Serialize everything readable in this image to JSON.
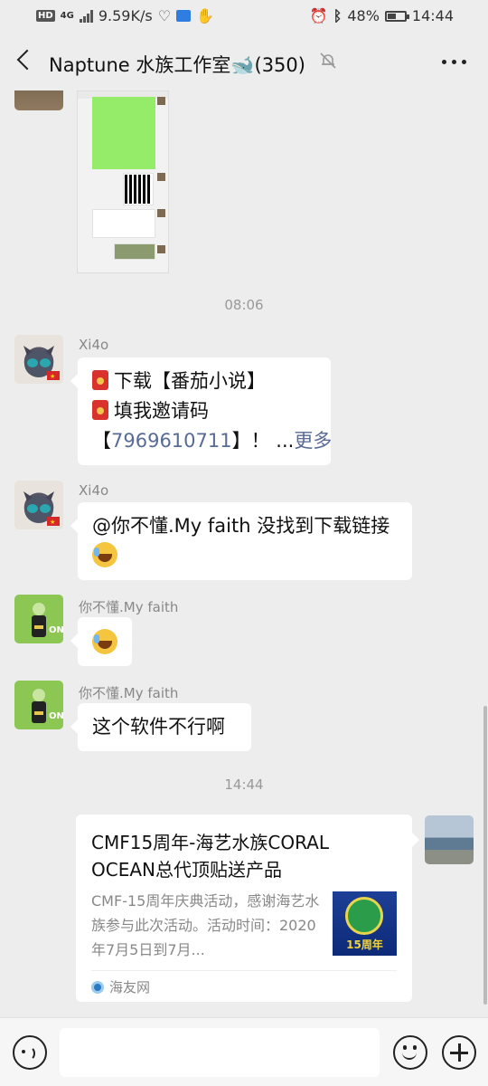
{
  "status_bar": {
    "hd": "HD",
    "net": "4G",
    "speed": "9.59K/s",
    "battery": "48%",
    "time": "14:44"
  },
  "header": {
    "title": "Naptune 水族工作室🐋(350)",
    "icons": [
      "back-icon",
      "mute-bell-icon",
      "more-icon"
    ]
  },
  "timestamps": [
    "08:06",
    "14:44"
  ],
  "messages": [
    {
      "sender": "Xi4o",
      "line1": "下载【番茄小说】",
      "line2": "填我邀请码",
      "line3_prefix": "【",
      "code": "7969610711",
      "line3_suffix": "】！ ...",
      "more": "更多"
    },
    {
      "sender": "Xi4o",
      "text": "@你不懂.My faith  没找到下载链接"
    },
    {
      "sender": "你不懂.My faith"
    },
    {
      "sender": "你不懂.My faith",
      "text": "这个软件不行啊"
    }
  ],
  "link_card": {
    "title": "CMF15周年-海艺水族CORAL OCEAN总代顶贴送产品",
    "description": "CMF-15周年庆典活动，感谢海艺水族参与此次活动。活动时间：2020年7月5日到7月...",
    "thumb_label": "15周年",
    "source": "海友网"
  },
  "input": {
    "placeholder": ""
  },
  "colors": {
    "background": "#ededed",
    "bubble": "#ffffff",
    "link": "#576b95",
    "sent_bubble": "#95ec69"
  }
}
